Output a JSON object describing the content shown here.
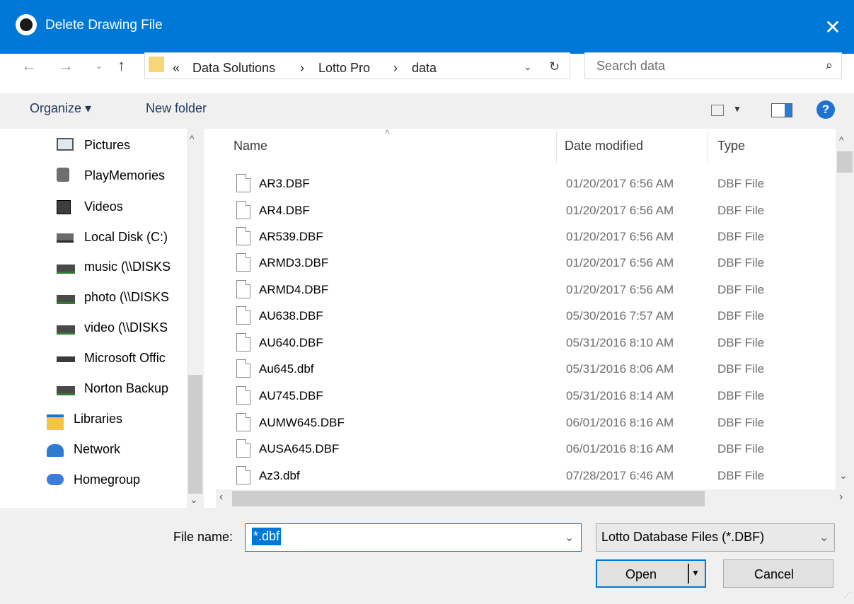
{
  "window": {
    "title": "Delete Drawing File",
    "close_glyph": "✕"
  },
  "address": {
    "breadcrumb_prefix": "«",
    "crumbs": [
      "Data Solutions",
      "Lotto Pro",
      "data"
    ],
    "separator": "›",
    "search_placeholder": "Search data"
  },
  "toolbar": {
    "organize": "Organize ▾",
    "new_folder": "New folder",
    "help": "?"
  },
  "nav": {
    "items": [
      "Pictures",
      "PlayMemories",
      "Videos",
      "Local Disk (C:)",
      "music (\\\\DISKS",
      "photo (\\\\DISKS",
      "video (\\\\DISKS",
      "Microsoft Offic",
      "Norton Backup",
      "Libraries",
      "Network",
      "Homegroup"
    ]
  },
  "columns": {
    "name": "Name",
    "date": "Date modified",
    "type": "Type"
  },
  "files": [
    {
      "name": "AR3.DBF",
      "date": "01/20/2017 6:56 AM",
      "type": "DBF File"
    },
    {
      "name": "AR4.DBF",
      "date": "01/20/2017 6:56 AM",
      "type": "DBF File"
    },
    {
      "name": "AR539.DBF",
      "date": "01/20/2017 6:56 AM",
      "type": "DBF File"
    },
    {
      "name": "ARMD3.DBF",
      "date": "01/20/2017 6:56 AM",
      "type": "DBF File"
    },
    {
      "name": "ARMD4.DBF",
      "date": "01/20/2017 6:56 AM",
      "type": "DBF File"
    },
    {
      "name": "AU638.DBF",
      "date": "05/30/2016 7:57 AM",
      "type": "DBF File"
    },
    {
      "name": "AU640.DBF",
      "date": "05/31/2016 8:10 AM",
      "type": "DBF File"
    },
    {
      "name": "Au645.dbf",
      "date": "05/31/2016 8:06 AM",
      "type": "DBF File"
    },
    {
      "name": "AU745.DBF",
      "date": "05/31/2016 8:14 AM",
      "type": "DBF File"
    },
    {
      "name": "AUMW645.DBF",
      "date": "06/01/2016 8:16 AM",
      "type": "DBF File"
    },
    {
      "name": "AUSA645.DBF",
      "date": "06/01/2016 8:16 AM",
      "type": "DBF File"
    },
    {
      "name": "Az3.dbf",
      "date": "07/28/2017 6:46 AM",
      "type": "DBF File"
    }
  ],
  "footer": {
    "file_name_label": "File name:",
    "file_name_value": "*.dbf",
    "filter_value": "Lotto Database Files (*.DBF)",
    "open_label": "Open",
    "cancel_label": "Cancel"
  },
  "colors": {
    "title_bar": "#0078d7",
    "selection": "#0078d7",
    "panel": "#f0f0f0"
  }
}
